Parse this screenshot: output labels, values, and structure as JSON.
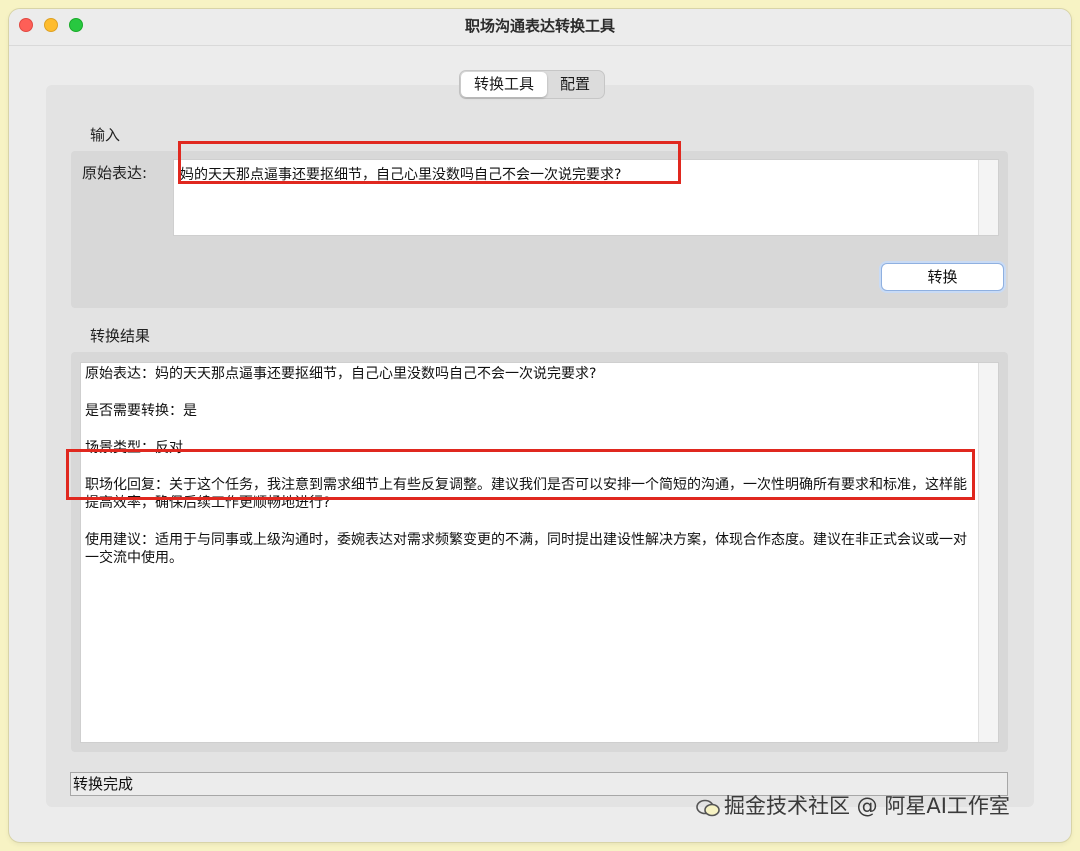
{
  "window": {
    "title": "职场沟通表达转换工具"
  },
  "tabs": [
    {
      "label": "转换工具",
      "active": true
    },
    {
      "label": "配置",
      "active": false
    }
  ],
  "input_section": {
    "label": "输入",
    "field_label": "原始表达:",
    "value": "妈的天天那点逼事还要抠细节，自己心里没数吗自己不会一次说完要求?",
    "convert_button": "转换"
  },
  "result_section": {
    "label": "转换结果",
    "lines": [
      "原始表达：妈的天天那点逼事还要抠细节，自己心里没数吗自己不会一次说完要求?",
      "是否需要转换：是",
      "场景类型：反对",
      "职场化回复：关于这个任务，我注意到需求细节上有些反复调整。建议我们是否可以安排一个简短的沟通，一次性明确所有要求和标准，这样能提高效率，确保后续工作更顺畅地进行?",
      "使用建议：适用于与同事或上级沟通时，委婉表达对需求频繁变更的不满，同时提出建设性解决方案，体现合作态度。建议在非正式会议或一对一交流中使用。"
    ]
  },
  "status": {
    "text": "转换完成"
  },
  "watermark": {
    "text": "掘金技术社区 @ 阿星AI工作室",
    "icon": "wechat-icon"
  },
  "colors": {
    "highlight": "#e0281f",
    "button_focus": "#8fb0e0"
  }
}
